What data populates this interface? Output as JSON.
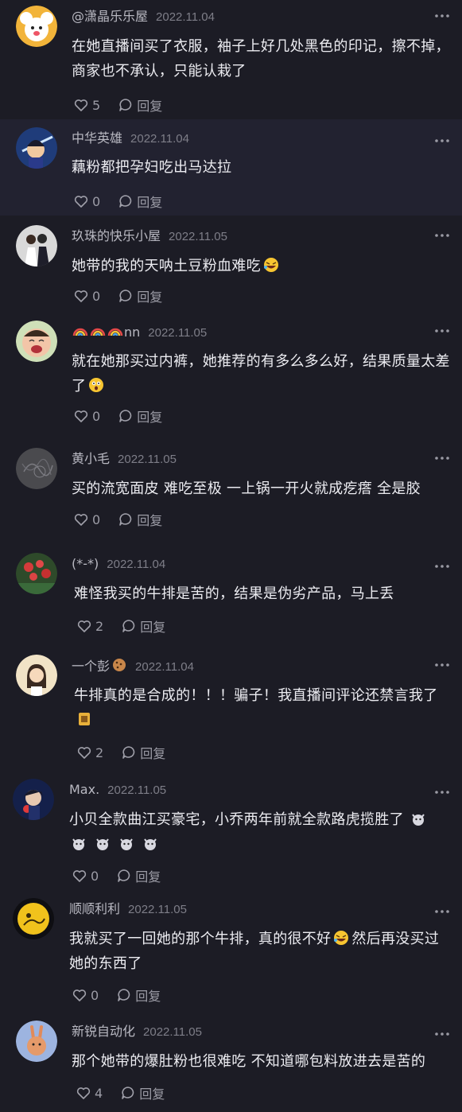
{
  "comments": [
    {
      "username": "@潇晶乐乐屋",
      "date": "2022.11.04",
      "text": "在她直播间买了衣服，袖子上好几处黑色的印记，擦不掉，商家也不承认，只能认栽了",
      "likes": "5",
      "reply_label": "回复",
      "avatar_icon": "cartoon-mouse-avatar"
    },
    {
      "username": "中华英雄",
      "date": "2022.11.04",
      "text": "藕粉都把孕妇吃出马达拉",
      "likes": "0",
      "reply_label": "回复",
      "avatar_icon": "anime-detective-avatar"
    },
    {
      "username": "玖珠的快乐小屋",
      "date": "2022.11.05",
      "text": "她带的我的天呐土豆粉血难吃",
      "likes": "0",
      "reply_label": "回复",
      "avatar_icon": "couple-photo-avatar"
    },
    {
      "username": "nn",
      "date": "2022.11.05",
      "text": "就在她那买过内裤，她推荐的有多么多么好，结果质量太差了",
      "likes": "0",
      "reply_label": "回复",
      "avatar_icon": "crying-baby-avatar"
    },
    {
      "username": "黄小毛",
      "date": "2022.11.05",
      "text": "买的流宽面皮 难吃至极 一上锅一开火就成疙瘩 全是胶",
      "likes": "0",
      "reply_label": "回复",
      "avatar_icon": "gray-sketch-avatar"
    },
    {
      "username": "(*-*)",
      "date": "2022.11.04",
      "text": "难怪我买的牛排是苦的，结果是伪劣产品，马上丢",
      "likes": "2",
      "reply_label": "回复",
      "avatar_icon": "red-flowers-avatar"
    },
    {
      "username": "一个彭",
      "date": "2022.11.04",
      "text": "牛排真的是合成的！！！骗子！我直播间评论还禁言我了",
      "likes": "2",
      "reply_label": "回复",
      "avatar_icon": "cartoon-girl-avatar"
    },
    {
      "username": "Max.",
      "date": "2022.11.05",
      "text": "小贝全款曲江买豪宅，小乔两年前就全款路虎揽胜了",
      "likes": "0",
      "reply_label": "回复",
      "avatar_icon": "anime-boy-avatar"
    },
    {
      "username": "顺顺利利",
      "date": "2022.11.05",
      "text": "我就买了一回她的那个牛排，真的很不好",
      "text_after": "然后再没买过她的东西了",
      "likes": "0",
      "reply_label": "回复",
      "avatar_icon": "moon-avatar"
    },
    {
      "username": "新锐自动化",
      "date": "2022.11.05",
      "text": "那个她带的爆肚粉也很难吃 不知道哪包料放进去是苦的",
      "likes": "4",
      "reply_label": "回复",
      "avatar_icon": "cartoon-rabbit-avatar"
    }
  ],
  "icons": {
    "like": "heart-outline-icon",
    "reply": "speech-bubble-icon",
    "more": "ellipsis-icon"
  }
}
